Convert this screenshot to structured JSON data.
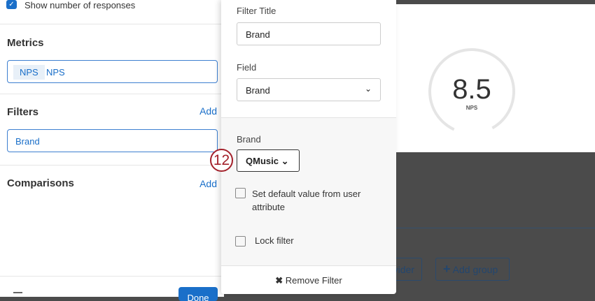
{
  "left": {
    "show_responses": "Show number of responses",
    "metrics_title": "Metrics",
    "metric_tag": "NPS",
    "metric_name": "NPS",
    "filters_title": "Filters",
    "filters_add": "Add",
    "filter_item": "Brand",
    "comparisons_title": "Comparisons",
    "comparisons_add": "Add",
    "done": "Done"
  },
  "popover": {
    "filter_title_label": "Filter Title",
    "filter_title_value": "Brand",
    "field_label": "Field",
    "field_value": "Brand",
    "brand_label": "Brand",
    "brand_value": "QMusic",
    "default_value_label": "Set default value from user attribute",
    "lock_label": "Lock filter",
    "remove_label": "Remove Filter"
  },
  "gauge": {
    "value": "8.5",
    "label": "NPS",
    "fraction": 0.85
  },
  "background": {
    "divider_btn": "vider",
    "add_group": "Add group"
  },
  "step_badge": "12"
}
